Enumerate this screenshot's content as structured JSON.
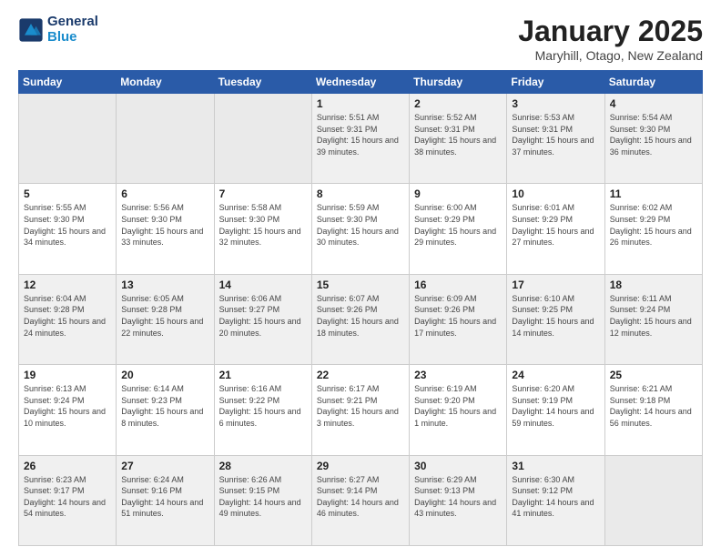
{
  "header": {
    "logo_line1": "General",
    "logo_line2": "Blue",
    "month": "January 2025",
    "location": "Maryhill, Otago, New Zealand"
  },
  "weekdays": [
    "Sunday",
    "Monday",
    "Tuesday",
    "Wednesday",
    "Thursday",
    "Friday",
    "Saturday"
  ],
  "weeks": [
    [
      {
        "day": "",
        "info": ""
      },
      {
        "day": "",
        "info": ""
      },
      {
        "day": "",
        "info": ""
      },
      {
        "day": "1",
        "info": "Sunrise: 5:51 AM\nSunset: 9:31 PM\nDaylight: 15 hours\nand 39 minutes."
      },
      {
        "day": "2",
        "info": "Sunrise: 5:52 AM\nSunset: 9:31 PM\nDaylight: 15 hours\nand 38 minutes."
      },
      {
        "day": "3",
        "info": "Sunrise: 5:53 AM\nSunset: 9:31 PM\nDaylight: 15 hours\nand 37 minutes."
      },
      {
        "day": "4",
        "info": "Sunrise: 5:54 AM\nSunset: 9:30 PM\nDaylight: 15 hours\nand 36 minutes."
      }
    ],
    [
      {
        "day": "5",
        "info": "Sunrise: 5:55 AM\nSunset: 9:30 PM\nDaylight: 15 hours\nand 34 minutes."
      },
      {
        "day": "6",
        "info": "Sunrise: 5:56 AM\nSunset: 9:30 PM\nDaylight: 15 hours\nand 33 minutes."
      },
      {
        "day": "7",
        "info": "Sunrise: 5:58 AM\nSunset: 9:30 PM\nDaylight: 15 hours\nand 32 minutes."
      },
      {
        "day": "8",
        "info": "Sunrise: 5:59 AM\nSunset: 9:30 PM\nDaylight: 15 hours\nand 30 minutes."
      },
      {
        "day": "9",
        "info": "Sunrise: 6:00 AM\nSunset: 9:29 PM\nDaylight: 15 hours\nand 29 minutes."
      },
      {
        "day": "10",
        "info": "Sunrise: 6:01 AM\nSunset: 9:29 PM\nDaylight: 15 hours\nand 27 minutes."
      },
      {
        "day": "11",
        "info": "Sunrise: 6:02 AM\nSunset: 9:29 PM\nDaylight: 15 hours\nand 26 minutes."
      }
    ],
    [
      {
        "day": "12",
        "info": "Sunrise: 6:04 AM\nSunset: 9:28 PM\nDaylight: 15 hours\nand 24 minutes."
      },
      {
        "day": "13",
        "info": "Sunrise: 6:05 AM\nSunset: 9:28 PM\nDaylight: 15 hours\nand 22 minutes."
      },
      {
        "day": "14",
        "info": "Sunrise: 6:06 AM\nSunset: 9:27 PM\nDaylight: 15 hours\nand 20 minutes."
      },
      {
        "day": "15",
        "info": "Sunrise: 6:07 AM\nSunset: 9:26 PM\nDaylight: 15 hours\nand 18 minutes."
      },
      {
        "day": "16",
        "info": "Sunrise: 6:09 AM\nSunset: 9:26 PM\nDaylight: 15 hours\nand 17 minutes."
      },
      {
        "day": "17",
        "info": "Sunrise: 6:10 AM\nSunset: 9:25 PM\nDaylight: 15 hours\nand 14 minutes."
      },
      {
        "day": "18",
        "info": "Sunrise: 6:11 AM\nSunset: 9:24 PM\nDaylight: 15 hours\nand 12 minutes."
      }
    ],
    [
      {
        "day": "19",
        "info": "Sunrise: 6:13 AM\nSunset: 9:24 PM\nDaylight: 15 hours\nand 10 minutes."
      },
      {
        "day": "20",
        "info": "Sunrise: 6:14 AM\nSunset: 9:23 PM\nDaylight: 15 hours\nand 8 minutes."
      },
      {
        "day": "21",
        "info": "Sunrise: 6:16 AM\nSunset: 9:22 PM\nDaylight: 15 hours\nand 6 minutes."
      },
      {
        "day": "22",
        "info": "Sunrise: 6:17 AM\nSunset: 9:21 PM\nDaylight: 15 hours\nand 3 minutes."
      },
      {
        "day": "23",
        "info": "Sunrise: 6:19 AM\nSunset: 9:20 PM\nDaylight: 15 hours\nand 1 minute."
      },
      {
        "day": "24",
        "info": "Sunrise: 6:20 AM\nSunset: 9:19 PM\nDaylight: 14 hours\nand 59 minutes."
      },
      {
        "day": "25",
        "info": "Sunrise: 6:21 AM\nSunset: 9:18 PM\nDaylight: 14 hours\nand 56 minutes."
      }
    ],
    [
      {
        "day": "26",
        "info": "Sunrise: 6:23 AM\nSunset: 9:17 PM\nDaylight: 14 hours\nand 54 minutes."
      },
      {
        "day": "27",
        "info": "Sunrise: 6:24 AM\nSunset: 9:16 PM\nDaylight: 14 hours\nand 51 minutes."
      },
      {
        "day": "28",
        "info": "Sunrise: 6:26 AM\nSunset: 9:15 PM\nDaylight: 14 hours\nand 49 minutes."
      },
      {
        "day": "29",
        "info": "Sunrise: 6:27 AM\nSunset: 9:14 PM\nDaylight: 14 hours\nand 46 minutes."
      },
      {
        "day": "30",
        "info": "Sunrise: 6:29 AM\nSunset: 9:13 PM\nDaylight: 14 hours\nand 43 minutes."
      },
      {
        "day": "31",
        "info": "Sunrise: 6:30 AM\nSunset: 9:12 PM\nDaylight: 14 hours\nand 41 minutes."
      },
      {
        "day": "",
        "info": ""
      }
    ]
  ]
}
